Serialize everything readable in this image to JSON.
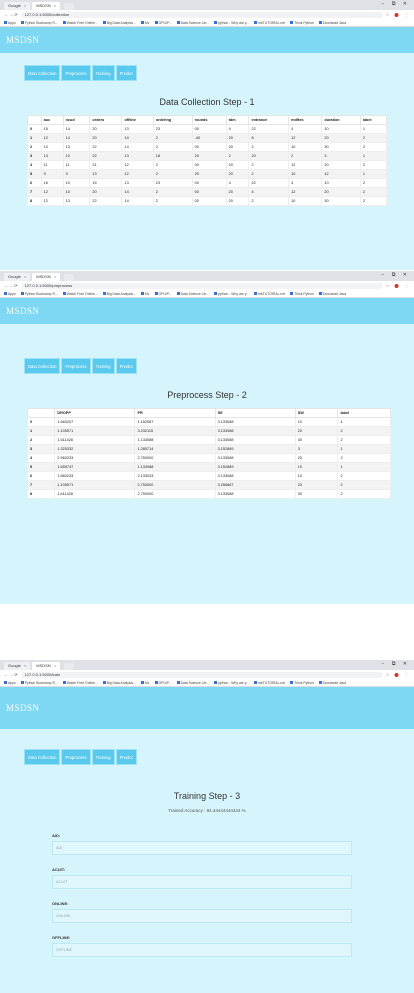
{
  "browser": {
    "tab1": "Google",
    "tab2": "MSDSN",
    "window_controls": "− ⧉ ✕",
    "bookmarks": [
      "Apps",
      "Python Bootcamp R...",
      "Watch Free Online...",
      "Big Data Analysis...",
      "ML",
      "GPU/P...",
      "Data Science Lib...",
      "python - Why are y...",
      "mbTUTORIAL.net",
      "Think Python",
      "Download Java"
    ],
    "ext_icons": "☆ ⬤ ⋮"
  },
  "app": {
    "title": "MSDSN",
    "nav": [
      "Data Collection",
      "Preprocess",
      "Training",
      "Predict"
    ]
  },
  "shot1": {
    "url": "127.0.0.1:5000/collection",
    "step_title": "Data Collection Step - 1",
    "columns": [
      "",
      "auc",
      "ncud",
      "orders",
      "offline",
      "ordering",
      "rounds",
      "tdm",
      "entrance",
      "mdftes",
      "duration",
      "label"
    ],
    "rows": [
      [
        "0",
        "15",
        "14",
        "20",
        "13",
        "23",
        "00",
        "4",
        "22",
        "4",
        "10",
        "1"
      ],
      [
        "1",
        "12",
        "14",
        "20",
        "14",
        "2",
        "-40",
        "20",
        "8",
        "12",
        "20",
        "2"
      ],
      [
        "2",
        "10",
        "13",
        "22",
        "14",
        "2",
        "00",
        "20",
        "2",
        "10",
        "30",
        "2"
      ],
      [
        "3",
        "13",
        "10",
        "22",
        "13",
        "18",
        "20",
        "2",
        "20",
        "2",
        "3",
        "1"
      ],
      [
        "4",
        "11",
        "11",
        "21",
        "12",
        "2",
        "00",
        "20",
        "2",
        "12",
        "20",
        "2"
      ],
      [
        "5",
        "9",
        "9",
        "13",
        "12",
        "2",
        "20",
        "20",
        "2",
        "10",
        "12",
        "1"
      ],
      [
        "6",
        "16",
        "10",
        "15",
        "13",
        "23",
        "00",
        "4",
        "22",
        "4",
        "10",
        "2"
      ],
      [
        "7",
        "12",
        "10",
        "20",
        "14",
        "2",
        "00",
        "20",
        "4",
        "12",
        "20",
        "2"
      ],
      [
        "8",
        "12",
        "13",
        "22",
        "14",
        "2",
        "00",
        "20",
        "2",
        "10",
        "30",
        "2"
      ]
    ]
  },
  "shot2": {
    "url": "127.0.0.1:5000/preprocess",
    "step_title": "Preprocess Step - 2",
    "columns": [
      "",
      "DROPP",
      "PR",
      "SE",
      "SW",
      "label"
    ],
    "rows": [
      [
        "0",
        "1.660207",
        "1.152087",
        "3.133088",
        "10",
        "1"
      ],
      [
        "1",
        "1.105571",
        "3.232115",
        "3.133088",
        "20",
        "2"
      ],
      [
        "2",
        "1.611426",
        "1.133088",
        "3.133088",
        "30",
        "2"
      ],
      [
        "3",
        "1.325332",
        "1.285714",
        "3.152889",
        "3",
        "1"
      ],
      [
        "4",
        "2.960233",
        "2.750000",
        "3.133088",
        "20",
        "2"
      ],
      [
        "5",
        "1.659747",
        "1.133088",
        "3.152889",
        "10",
        "1"
      ],
      [
        "6",
        "1.660233",
        "2.133033",
        "3.133088",
        "10",
        "2"
      ],
      [
        "7",
        "1.105571",
        "2.750000",
        "3.256667",
        "20",
        "2"
      ],
      [
        "8",
        "1.611426",
        "2.750000",
        "3.133088",
        "30",
        "2"
      ]
    ]
  },
  "shot3": {
    "url": "127.0.0.1:5000/train",
    "step_title": "Training Step - 3",
    "accuracy": "Trained Accuracy : 94.44444444444 %",
    "fields": [
      {
        "label": "AID:",
        "placeholder": "AID"
      },
      {
        "label": "ACUIT:",
        "placeholder": "ACUIT"
      },
      {
        "label": "ONLINE:",
        "placeholder": "ONLINE"
      },
      {
        "label": "OFFLINE:",
        "placeholder": "OFFLINE"
      }
    ]
  }
}
